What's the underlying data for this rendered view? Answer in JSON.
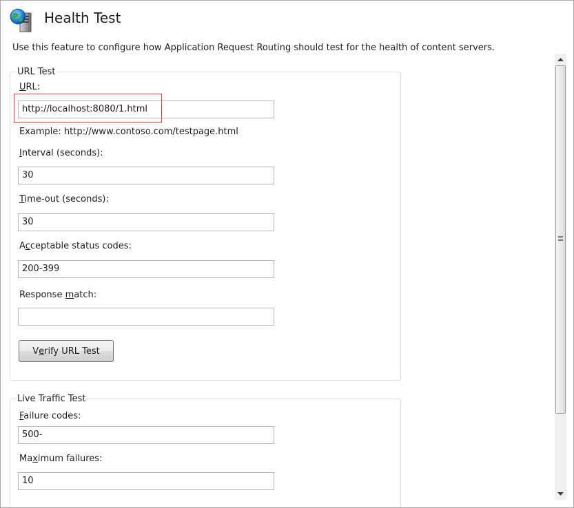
{
  "header": {
    "title": "Health Test",
    "icon": "globe-server-icon"
  },
  "description": "Use this feature to configure how Application Request Routing should test for the health of content servers.",
  "url_test": {
    "legend": "URL Test",
    "url": {
      "label_accel": "U",
      "label_rest": "RL:",
      "value": "http://localhost:8080/1.html"
    },
    "example": "Example: http://www.contoso.com/testpage.html",
    "interval": {
      "label_accel": "I",
      "label_rest": "nterval (seconds):",
      "value": "30"
    },
    "timeout": {
      "label_accel": "T",
      "label_rest": "ime-out (seconds):",
      "value": "30"
    },
    "status_codes": {
      "label_pre": "A",
      "label_accel": "c",
      "label_rest": "ceptable status codes:",
      "value": "200-399"
    },
    "response_match": {
      "label_pre": "Response ",
      "label_accel": "m",
      "label_rest": "atch:",
      "value": ""
    },
    "verify_button": {
      "label_pre": "V",
      "label_accel": "e",
      "label_rest": "rify URL Test"
    }
  },
  "live_traffic_test": {
    "legend": "Live Traffic Test",
    "failure_codes": {
      "label_accel": "F",
      "label_rest": "ailure codes:",
      "value": "500-"
    },
    "max_failures": {
      "label_pre": "Ma",
      "label_accel": "x",
      "label_rest": "imum failures:",
      "value": "10"
    }
  },
  "colors": {
    "highlight": "#e83a3a",
    "group_border": "#d5dfe5"
  }
}
